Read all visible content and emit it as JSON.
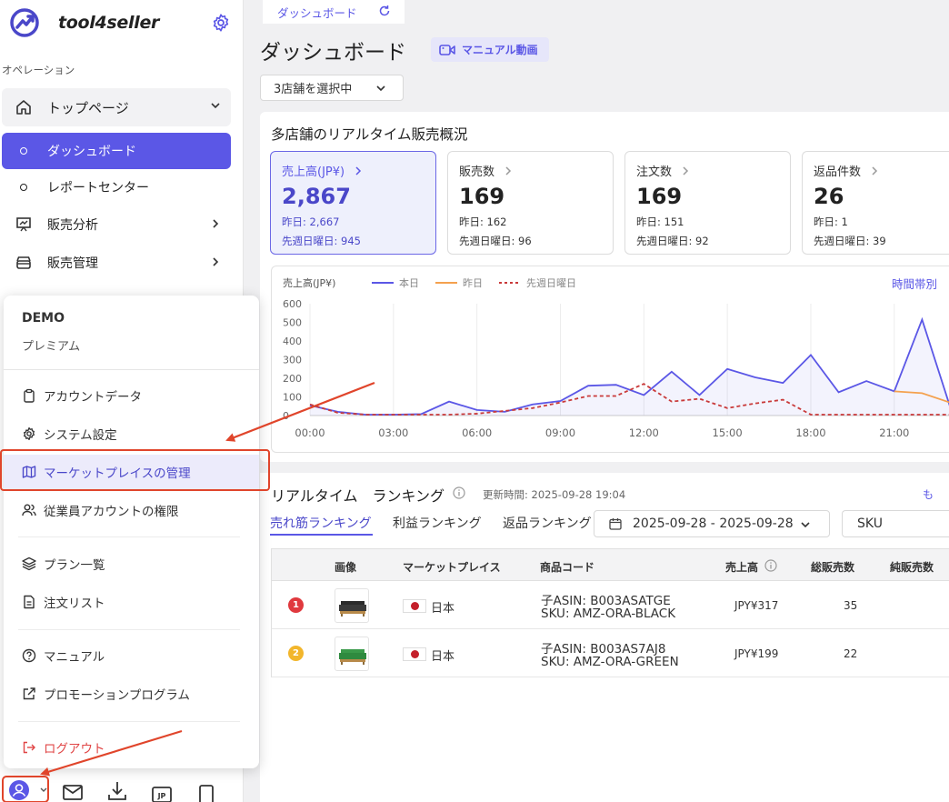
{
  "brand": {
    "name": "tool4seller"
  },
  "sidebar": {
    "section_label": "オペレーション",
    "items": [
      {
        "label": "トップページ"
      },
      {
        "label": "ダッシュボード"
      },
      {
        "label": "レポートセンター"
      },
      {
        "label": "販売分析"
      },
      {
        "label": "販売管理"
      }
    ]
  },
  "popup": {
    "account_name": "DEMO",
    "plan": "プレミアム",
    "items": [
      {
        "label": "アカウントデータ"
      },
      {
        "label": "システム設定"
      },
      {
        "label": "マーケットプレイスの管理"
      },
      {
        "label": "従業員アカウントの権限"
      },
      {
        "label": "プラン一覧"
      },
      {
        "label": "注文リスト"
      },
      {
        "label": "マニュアル"
      },
      {
        "label": "プロモーションプログラム"
      },
      {
        "label": "ログアウト"
      }
    ]
  },
  "tab": {
    "label": "ダッシュボード"
  },
  "page": {
    "title": "ダッシュボード",
    "manual_button": "マニュアル動画",
    "store_select": "3店舗を選択中"
  },
  "overview": {
    "title": "多店舗のリアルタイム販売概況",
    "kpis": [
      {
        "title": "売上高(JP¥)",
        "value": "2,867",
        "yesterday": "昨日: 2,667",
        "last_week": "先週日曜日: 945"
      },
      {
        "title": "販売数",
        "value": "169",
        "yesterday": "昨日: 162",
        "last_week": "先週日曜日: 96"
      },
      {
        "title": "注文数",
        "value": "169",
        "yesterday": "昨日: 151",
        "last_week": "先週日曜日: 92"
      },
      {
        "title": "返品件数",
        "value": "26",
        "yesterday": "昨日: 1",
        "last_week": "先週日曜日: 39"
      }
    ],
    "time_link": "時間帯別"
  },
  "chart_data": {
    "type": "line",
    "ylabel": "売上高(JP¥)",
    "ylim": [
      0,
      600
    ],
    "yticks": [
      "600",
      "500",
      "400",
      "300",
      "200",
      "100",
      "0"
    ],
    "xticks": [
      "00:00",
      "03:00",
      "06:00",
      "09:00",
      "12:00",
      "15:00",
      "18:00",
      "21:00"
    ],
    "x": [
      0,
      1,
      2,
      3,
      4,
      5,
      6,
      7,
      8,
      9,
      10,
      11,
      12,
      13,
      14,
      15,
      16,
      17,
      18,
      19,
      20,
      21,
      22,
      23
    ],
    "series": [
      {
        "name": "本日",
        "color": "#5b57e6",
        "style": "solid",
        "values": [
          55,
          20,
          5,
          5,
          8,
          75,
          30,
          20,
          60,
          78,
          160,
          165,
          110,
          235,
          110,
          250,
          205,
          175,
          325,
          125,
          185,
          130,
          515,
          50
        ]
      },
      {
        "name": "昨日",
        "color": "#f4a14e",
        "style": "solid",
        "values": [
          null,
          null,
          null,
          null,
          null,
          null,
          null,
          null,
          null,
          null,
          null,
          null,
          null,
          null,
          null,
          null,
          null,
          null,
          null,
          null,
          null,
          130,
          120,
          70
        ]
      },
      {
        "name": "先週日曜日",
        "color": "#c93a3a",
        "style": "dashed",
        "values": [
          60,
          15,
          5,
          5,
          5,
          5,
          10,
          25,
          40,
          70,
          105,
          105,
          170,
          75,
          90,
          40,
          65,
          85,
          5,
          5,
          5,
          5,
          5,
          5
        ]
      }
    ],
    "fill_series": "本日",
    "grid": true
  },
  "ranking": {
    "title": "リアルタイム　ランキング",
    "updated": "更新時間: 2025-09-28 19:04",
    "more": "も",
    "tabs": [
      "売れ筋ランキング",
      "利益ランキング",
      "返品ランキング"
    ],
    "date_range": "2025-09-28 - 2025-09-28",
    "sku_select": "SKU",
    "columns": [
      "画像",
      "マーケットプレイス",
      "商品コード",
      "売上高",
      "総販売数",
      "純販売数"
    ],
    "rows": [
      {
        "rank": "1",
        "rank_color": "#e0393e",
        "country": "日本",
        "asin": "子ASIN: B003ASATGE",
        "sku": "SKU: AMZ-ORA-BLACK",
        "sales": "JPY¥317",
        "units": "35",
        "color": "#2b2b2b"
      },
      {
        "rank": "2",
        "rank_color": "#f2b62c",
        "country": "日本",
        "asin": "子ASIN: B003AS7AJ8",
        "sku": "SKU: AMZ-ORA-GREEN",
        "sales": "JPY¥199",
        "units": "22",
        "color": "#3a9a4a"
      }
    ]
  },
  "colors": {
    "accent": "#5b57e6",
    "annotation": "#e0452b"
  }
}
